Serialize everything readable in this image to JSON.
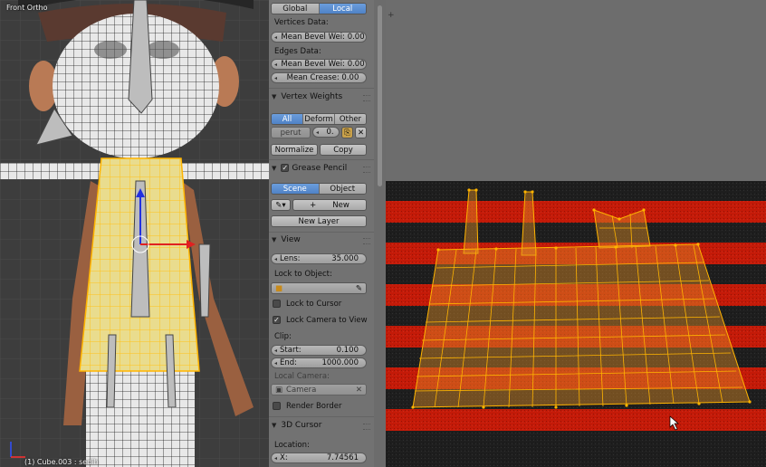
{
  "viewport": {
    "view_label": "Front Ortho",
    "object_label": "(1) Cube.003 : sedih"
  },
  "panel": {
    "orientation_tabs": [
      {
        "label": "Global",
        "active": false
      },
      {
        "label": "Local",
        "active": true
      }
    ],
    "vertices_data_label": "Vertices Data:",
    "vertex_bevel": {
      "label": "Mean Bevel Wei:",
      "value": "0.00"
    },
    "edges_data_label": "Edges Data:",
    "edge_bevel": {
      "label": "Mean Bevel Wei:",
      "value": "0.00"
    },
    "edge_crease": {
      "label": "Mean Crease:",
      "value": "0.00"
    },
    "vertex_weights": {
      "title": "Vertex Weights",
      "filter_tabs": [
        {
          "label": "All",
          "active": true
        },
        {
          "label": "Deform",
          "active": false
        },
        {
          "label": "Other",
          "active": false
        }
      ],
      "group_name": "perut",
      "group_value": "0.",
      "normalize_label": "Normalize",
      "copy_label": "Copy"
    },
    "grease_pencil": {
      "title": "Grease Pencil",
      "enabled": true,
      "source_tabs": [
        {
          "label": "Scene",
          "active": true
        },
        {
          "label": "Object",
          "active": false
        }
      ],
      "new_label": "New",
      "new_layer_label": "New Layer"
    },
    "view": {
      "title": "View",
      "lens": {
        "label": "Lens:",
        "value": "35.000"
      },
      "lock_to_object_label": "Lock to Object:",
      "lock_to_cursor": {
        "label": "Lock to Cursor",
        "checked": false
      },
      "lock_camera_to_view": {
        "label": "Lock Camera to View",
        "checked": true
      },
      "clip_label": "Clip:",
      "clip_start": {
        "label": "Start:",
        "value": "0.100"
      },
      "clip_end": {
        "label": "End:",
        "value": "1000.000"
      },
      "local_camera_label": "Local Camera:",
      "local_camera_value": "Camera",
      "render_border": {
        "label": "Render Border",
        "checked": false
      }
    },
    "cursor": {
      "title": "3D Cursor",
      "location_label": "Location:",
      "x": {
        "label": "X:",
        "value": "7.74561"
      }
    }
  },
  "colors": {
    "uv_red": "#c41a08",
    "uv_dark": "#1e1e1e",
    "selection": "#ffb400",
    "active_tab": "#5a8dd0"
  }
}
